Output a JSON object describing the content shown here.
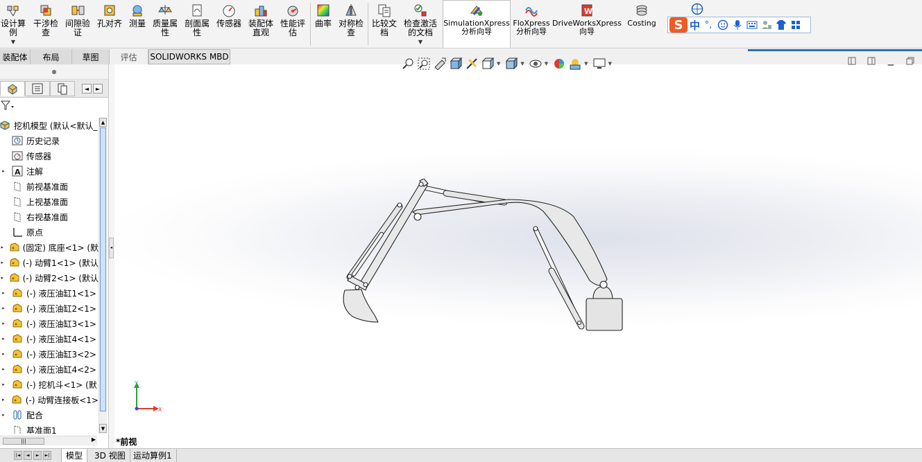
{
  "ribbon": {
    "buttons": [
      {
        "id": "design-study",
        "label": "设计算\n例"
      },
      {
        "id": "interference",
        "label": "干涉检\n查"
      },
      {
        "id": "clearance",
        "label": "间隙验\n证"
      },
      {
        "id": "hole-align",
        "label": "孔对齐"
      },
      {
        "id": "measure",
        "label": "测量"
      },
      {
        "id": "mass-props",
        "label": "质量属\n性"
      },
      {
        "id": "section-props",
        "label": "剖面属\n性"
      },
      {
        "id": "sensor",
        "label": "传感器"
      },
      {
        "id": "assembly-viz",
        "label": "装配体\n直观"
      },
      {
        "id": "performance",
        "label": "性能评\n估"
      },
      {
        "id": "curvature",
        "label": "曲率"
      },
      {
        "id": "symmetry",
        "label": "对称检\n查"
      },
      {
        "id": "compare-docs",
        "label": "比较文\n档"
      },
      {
        "id": "check-active",
        "label": "检查激活\n的文档"
      },
      {
        "id": "simxpress",
        "label": "SimulationXpress\n分析向导"
      },
      {
        "id": "floxpress",
        "label": "FloXpress\n分析向导"
      },
      {
        "id": "driveworks",
        "label": "DriveWorksXpress\n向导"
      },
      {
        "id": "costing",
        "label": "Costing"
      }
    ]
  },
  "ime": {
    "logo": "S",
    "lang": "中",
    "punct": "°,"
  },
  "tabs": {
    "items": [
      "装配体",
      "布局",
      "草图",
      "评估",
      "SOLIDWORKS MBD"
    ]
  },
  "tree": {
    "root": "挖机模型 (默认<默认_",
    "items": [
      {
        "label": "历史记录",
        "icon": "history-icon",
        "expand": false
      },
      {
        "label": "传感器",
        "icon": "sensor-icon",
        "expand": false
      },
      {
        "label": "注解",
        "icon": "annotation-icon",
        "expand": true
      },
      {
        "label": "前视基准面",
        "icon": "plane-icon",
        "expand": false
      },
      {
        "label": "上视基准面",
        "icon": "plane-icon",
        "expand": false
      },
      {
        "label": "右视基准面",
        "icon": "plane-icon",
        "expand": false
      },
      {
        "label": "原点",
        "icon": "origin-icon",
        "expand": false
      },
      {
        "label": "(固定) 底座<1> (默",
        "icon": "part-icon",
        "expand": true
      },
      {
        "label": "(-) 动臂1<1> (默认",
        "icon": "part-icon",
        "expand": true
      },
      {
        "label": "(-) 动臂2<1> (默认",
        "icon": "part-icon",
        "expand": true
      },
      {
        "label": "(-) 液压油缸1<1>",
        "icon": "part-icon",
        "expand": true
      },
      {
        "label": "(-) 液压油缸2<1>",
        "icon": "part-icon",
        "expand": true
      },
      {
        "label": "(-) 液压油缸3<1>",
        "icon": "part-icon",
        "expand": true
      },
      {
        "label": "(-) 液压油缸4<1>",
        "icon": "part-icon",
        "expand": true
      },
      {
        "label": "(-) 液压油缸3<2>",
        "icon": "part-icon",
        "expand": true
      },
      {
        "label": "(-) 液压油缸4<2>",
        "icon": "part-icon",
        "expand": true
      },
      {
        "label": "(-) 挖机斗<1> (默",
        "icon": "part-icon",
        "expand": true
      },
      {
        "label": "(-) 动臂连接板<1>",
        "icon": "part-icon",
        "expand": true
      },
      {
        "label": "配合",
        "icon": "mates-icon",
        "expand": true
      },
      {
        "label": "基准面1",
        "icon": "plane-icon",
        "expand": false
      }
    ]
  },
  "viewport": {
    "view_label": "*前视",
    "triad": {
      "x": "X",
      "y": "Y"
    }
  },
  "bottom_tabs": [
    "模型",
    "3D 视图",
    "运动算例1"
  ]
}
